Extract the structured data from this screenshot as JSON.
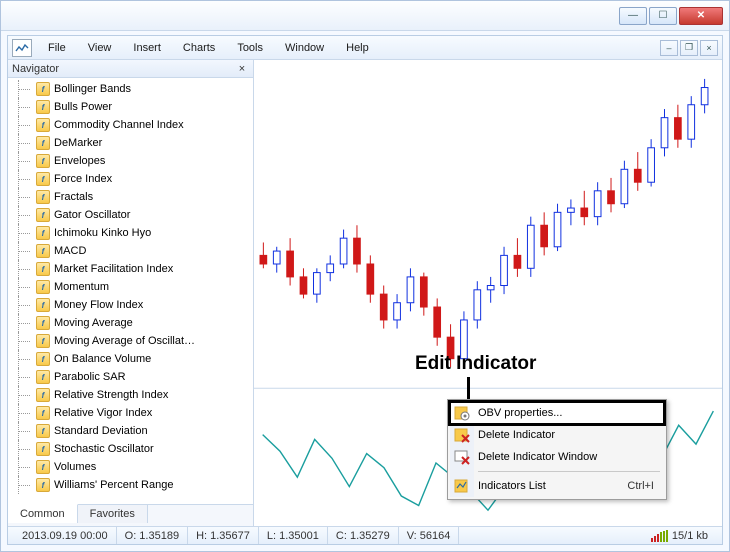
{
  "menu": {
    "file": "File",
    "view": "View",
    "insert": "Insert",
    "charts": "Charts",
    "tools": "Tools",
    "window": "Window",
    "help": "Help"
  },
  "navigator": {
    "title": "Navigator",
    "items": [
      "Bollinger Bands",
      "Bulls Power",
      "Commodity Channel Index",
      "DeMarker",
      "Envelopes",
      "Force Index",
      "Fractals",
      "Gator Oscillator",
      "Ichimoku Kinko Hyo",
      "MACD",
      "Market Facilitation Index",
      "Momentum",
      "Money Flow Index",
      "Moving Average",
      "Moving Average of Oscillat…",
      "On Balance Volume",
      "Parabolic SAR",
      "Relative Strength Index",
      "Relative Vigor Index",
      "Standard Deviation",
      "Stochastic Oscillator",
      "Volumes",
      "Williams' Percent Range"
    ],
    "tabs": {
      "common": "Common",
      "favorites": "Favorites"
    }
  },
  "context_menu": {
    "properties": "OBV properties...",
    "delete_indicator": "Delete Indicator",
    "delete_window": "Delete Indicator Window",
    "indicators_list": "Indicators List",
    "indicators_list_shortcut": "Ctrl+I"
  },
  "annotation": {
    "label": "Edit Indicator"
  },
  "status": {
    "datetime": "2013.09.19 00:00",
    "open": "O: 1.35189",
    "high": "H: 1.35677",
    "low": "L: 1.35001",
    "close": "C: 1.35279",
    "volume": "V: 56164",
    "conn": "15/1 kb"
  },
  "chart_data": {
    "type": "candlestick",
    "title": "",
    "candles": [
      {
        "o": 1.329,
        "h": 1.332,
        "l": 1.326,
        "c": 1.327,
        "up": false
      },
      {
        "o": 1.327,
        "h": 1.331,
        "l": 1.325,
        "c": 1.33,
        "up": true
      },
      {
        "o": 1.33,
        "h": 1.333,
        "l": 1.322,
        "c": 1.324,
        "up": false
      },
      {
        "o": 1.324,
        "h": 1.326,
        "l": 1.319,
        "c": 1.32,
        "up": false
      },
      {
        "o": 1.32,
        "h": 1.326,
        "l": 1.318,
        "c": 1.325,
        "up": true
      },
      {
        "o": 1.325,
        "h": 1.329,
        "l": 1.323,
        "c": 1.327,
        "up": true
      },
      {
        "o": 1.327,
        "h": 1.335,
        "l": 1.326,
        "c": 1.333,
        "up": true
      },
      {
        "o": 1.333,
        "h": 1.336,
        "l": 1.325,
        "c": 1.327,
        "up": false
      },
      {
        "o": 1.327,
        "h": 1.329,
        "l": 1.318,
        "c": 1.32,
        "up": false
      },
      {
        "o": 1.32,
        "h": 1.322,
        "l": 1.312,
        "c": 1.314,
        "up": false
      },
      {
        "o": 1.314,
        "h": 1.32,
        "l": 1.312,
        "c": 1.318,
        "up": true
      },
      {
        "o": 1.318,
        "h": 1.326,
        "l": 1.316,
        "c": 1.324,
        "up": true
      },
      {
        "o": 1.324,
        "h": 1.325,
        "l": 1.315,
        "c": 1.317,
        "up": false
      },
      {
        "o": 1.317,
        "h": 1.319,
        "l": 1.308,
        "c": 1.31,
        "up": false
      },
      {
        "o": 1.31,
        "h": 1.313,
        "l": 1.303,
        "c": 1.305,
        "up": false
      },
      {
        "o": 1.305,
        "h": 1.316,
        "l": 1.303,
        "c": 1.314,
        "up": true
      },
      {
        "o": 1.314,
        "h": 1.323,
        "l": 1.312,
        "c": 1.321,
        "up": true
      },
      {
        "o": 1.321,
        "h": 1.324,
        "l": 1.318,
        "c": 1.322,
        "up": true
      },
      {
        "o": 1.322,
        "h": 1.331,
        "l": 1.32,
        "c": 1.329,
        "up": true
      },
      {
        "o": 1.329,
        "h": 1.333,
        "l": 1.324,
        "c": 1.326,
        "up": false
      },
      {
        "o": 1.326,
        "h": 1.338,
        "l": 1.324,
        "c": 1.336,
        "up": true
      },
      {
        "o": 1.336,
        "h": 1.339,
        "l": 1.329,
        "c": 1.331,
        "up": false
      },
      {
        "o": 1.331,
        "h": 1.341,
        "l": 1.33,
        "c": 1.339,
        "up": true
      },
      {
        "o": 1.339,
        "h": 1.342,
        "l": 1.336,
        "c": 1.34,
        "up": true
      },
      {
        "o": 1.34,
        "h": 1.344,
        "l": 1.336,
        "c": 1.338,
        "up": false
      },
      {
        "o": 1.338,
        "h": 1.346,
        "l": 1.336,
        "c": 1.344,
        "up": true
      },
      {
        "o": 1.344,
        "h": 1.347,
        "l": 1.339,
        "c": 1.341,
        "up": false
      },
      {
        "o": 1.341,
        "h": 1.351,
        "l": 1.34,
        "c": 1.349,
        "up": true
      },
      {
        "o": 1.349,
        "h": 1.353,
        "l": 1.344,
        "c": 1.346,
        "up": false
      },
      {
        "o": 1.346,
        "h": 1.356,
        "l": 1.345,
        "c": 1.354,
        "up": true
      },
      {
        "o": 1.354,
        "h": 1.363,
        "l": 1.352,
        "c": 1.361,
        "up": true
      },
      {
        "o": 1.361,
        "h": 1.364,
        "l": 1.354,
        "c": 1.356,
        "up": false
      },
      {
        "o": 1.356,
        "h": 1.366,
        "l": 1.354,
        "c": 1.364,
        "up": true
      },
      {
        "o": 1.364,
        "h": 1.37,
        "l": 1.362,
        "c": 1.368,
        "up": true
      }
    ],
    "price_range": {
      "min": 1.3,
      "max": 1.372
    },
    "obv": [
      52,
      45,
      34,
      50,
      42,
      30,
      44,
      38,
      26,
      22,
      40,
      34,
      28,
      20,
      30,
      46,
      38,
      52,
      44,
      36,
      48,
      58,
      50,
      42,
      56,
      48,
      62
    ],
    "obv_range": {
      "min": 15,
      "max": 70
    }
  }
}
